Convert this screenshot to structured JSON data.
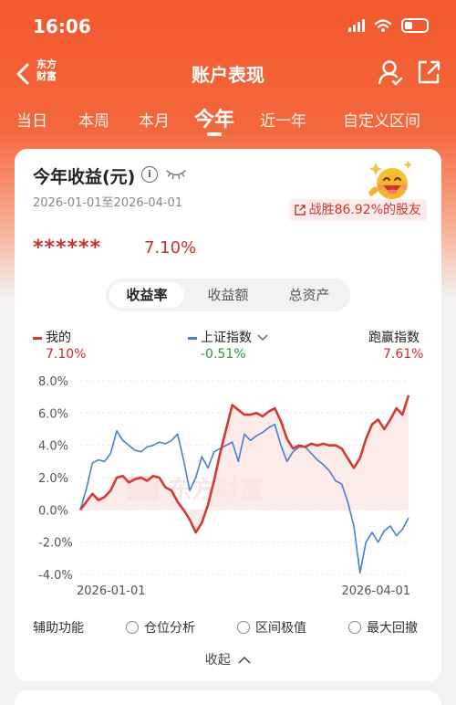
{
  "status": {
    "time": "16:06"
  },
  "nav": {
    "logo_line1": "东方",
    "logo_line2": "财富",
    "title": "账户表现"
  },
  "tabs": [
    {
      "label": "当日"
    },
    {
      "label": "本周"
    },
    {
      "label": "本月"
    },
    {
      "label": "今年",
      "active": true
    },
    {
      "label": "近一年"
    },
    {
      "label": "自定义区间"
    }
  ],
  "card": {
    "title": "今年收益(元)",
    "info_glyph": "i",
    "date_range": "2026-01-01至2026-04-01",
    "beat_text": "战胜86.92%的股友",
    "hidden_value": "******",
    "return_pct": "7.10%"
  },
  "segments": [
    {
      "label": "收益率",
      "active": true
    },
    {
      "label": "收益额"
    },
    {
      "label": "总资产"
    }
  ],
  "legend": {
    "mine": {
      "name": "我的",
      "value": "7.10%",
      "color": "#d23a33"
    },
    "index": {
      "name": "上证指数",
      "value": "-0.51%",
      "color": "#4a7fd0",
      "value_color": "#2f9a3e"
    },
    "benchmark": {
      "name": "跑赢指数",
      "value": "7.61%",
      "color": "#d23a33"
    }
  },
  "watermark": "东方财富",
  "chart_data": {
    "type": "line",
    "y_ticks": [
      "8.0%",
      "6.0%",
      "4.0%",
      "2.0%",
      "0.0%",
      "-2.0%",
      "-4.0%"
    ],
    "ylim": [
      -4,
      8
    ],
    "x_tick_labels": [
      "2026-01-01",
      "2026-04-01"
    ],
    "series": [
      {
        "name": "我的",
        "color": "#d23a33",
        "values": [
          0.0,
          0.5,
          1.0,
          0.6,
          0.8,
          1.2,
          2.0,
          2.1,
          1.7,
          1.9,
          2.0,
          1.8,
          2.1,
          2.0,
          1.4,
          1.2,
          0.5,
          0.0,
          -0.6,
          -1.4,
          -0.8,
          0.3,
          1.8,
          3.5,
          5.0,
          6.5,
          6.2,
          5.9,
          5.9,
          6.0,
          5.8,
          6.1,
          6.3,
          5.5,
          4.4,
          3.8,
          4.0,
          3.9,
          4.1,
          4.0,
          4.1,
          4.0,
          4.0,
          3.8,
          3.2,
          2.6,
          3.2,
          4.4,
          5.3,
          5.6,
          5.0,
          5.6,
          6.3,
          5.9,
          7.1
        ]
      },
      {
        "name": "上证指数",
        "color": "#4a7fd0",
        "values": [
          0.0,
          1.3,
          2.9,
          3.1,
          3.0,
          3.5,
          4.9,
          4.3,
          4.0,
          3.7,
          3.6,
          3.9,
          4.0,
          4.2,
          4.1,
          4.3,
          4.7,
          3.1,
          1.2,
          2.0,
          3.3,
          2.6,
          3.6,
          3.8,
          4.0,
          4.2,
          3.0,
          4.7,
          4.3,
          4.6,
          4.8,
          5.1,
          5.3,
          4.0,
          3.0,
          3.6,
          3.9,
          3.9,
          3.5,
          3.1,
          2.8,
          2.4,
          1.8,
          1.6,
          0.5,
          -1.0,
          -3.9,
          -2.0,
          -1.4,
          -2.0,
          -1.3,
          -1.0,
          -1.6,
          -1.2,
          -0.51
        ]
      }
    ]
  },
  "aux": {
    "label": "辅助功能",
    "options": [
      {
        "label": "仓位分析"
      },
      {
        "label": "区间极值"
      },
      {
        "label": "最大回撤"
      }
    ]
  },
  "collapse_label": "收起"
}
